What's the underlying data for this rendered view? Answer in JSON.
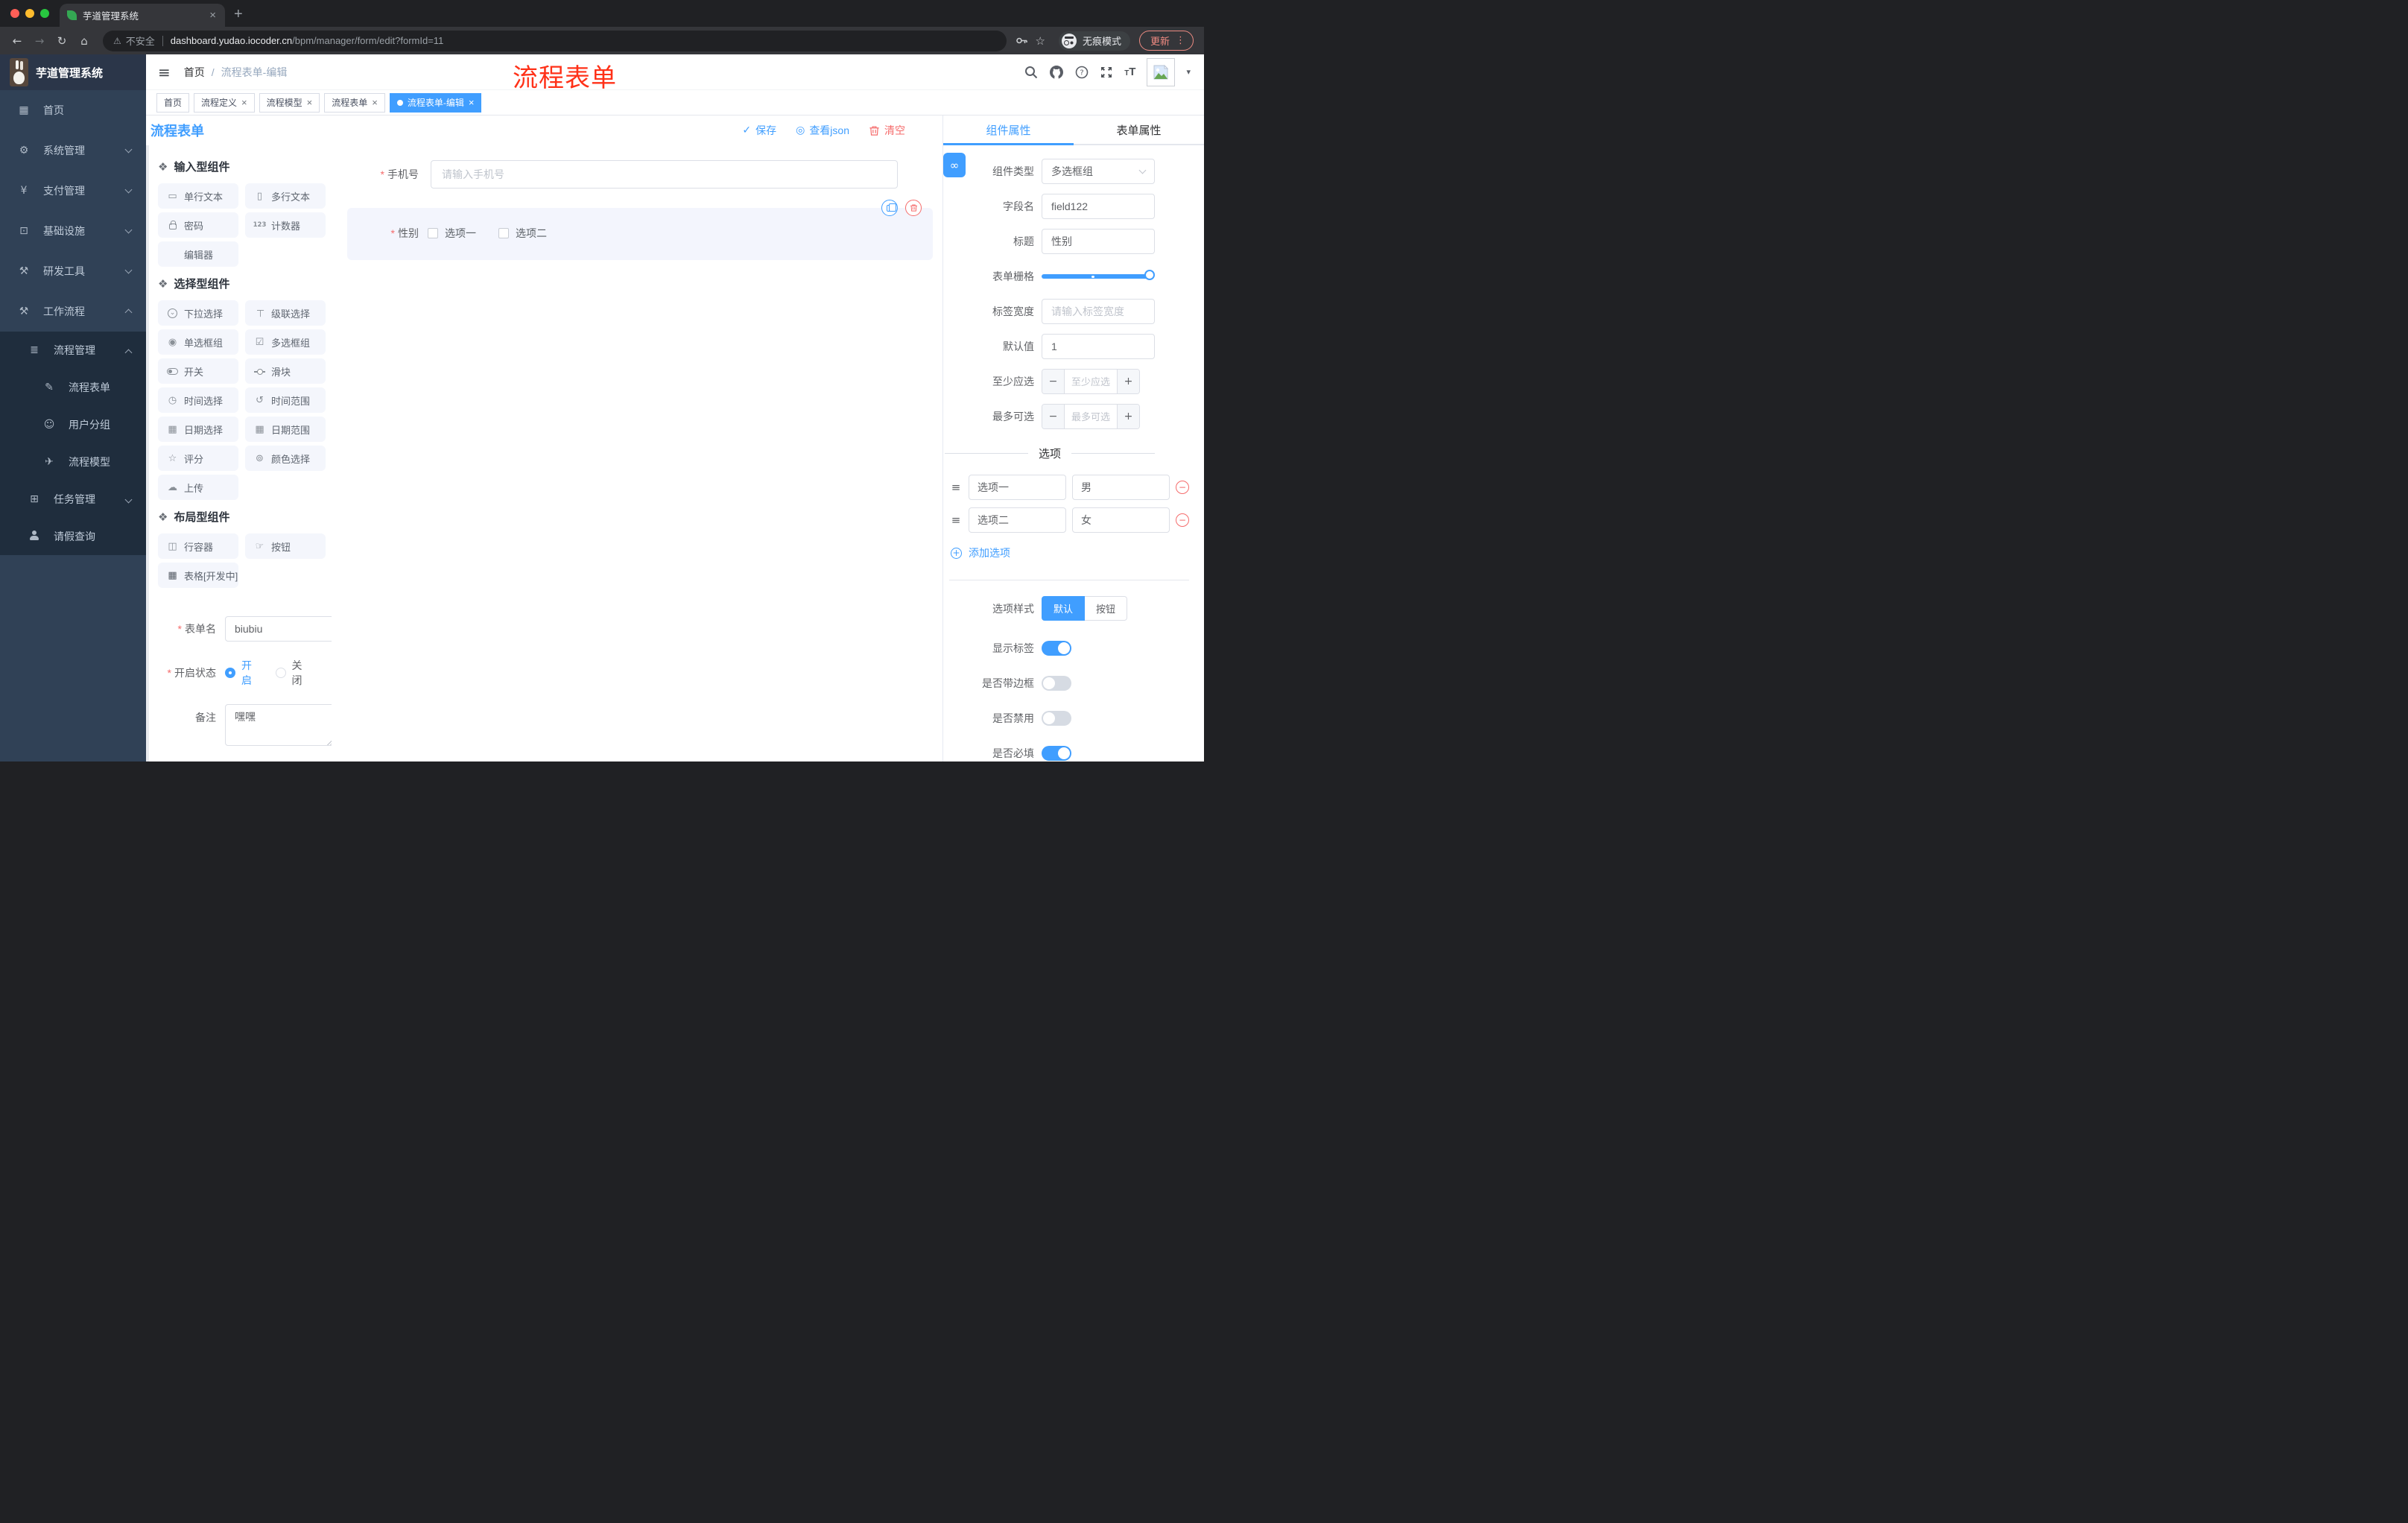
{
  "browser": {
    "tab_title": "芋道管理系统",
    "security_label": "不安全",
    "url_host": "dashboard.yudao.iocoder.cn",
    "url_path": "/bpm/manager/form/edit?formId=11",
    "incognito_label": "无痕模式",
    "update_label": "更新"
  },
  "sidebar": {
    "logo_title": "芋道管理系统",
    "items": [
      {
        "label": "首页",
        "icon": "dashboard-icon"
      },
      {
        "label": "系统管理",
        "icon": "gear-icon"
      },
      {
        "label": "支付管理",
        "icon": "yen-icon"
      },
      {
        "label": "基础设施",
        "icon": "monitor-icon"
      },
      {
        "label": "研发工具",
        "icon": "toolbox-icon"
      },
      {
        "label": "工作流程",
        "icon": "briefcase-icon"
      },
      {
        "label": "流程管理",
        "icon": "list-tree-icon"
      },
      {
        "label": "流程表单",
        "icon": "form-edit-icon"
      },
      {
        "label": "用户分组",
        "icon": "user-group-icon"
      },
      {
        "label": "流程模型",
        "icon": "paper-plane-icon"
      },
      {
        "label": "任务管理",
        "icon": "task-tree-icon"
      },
      {
        "label": "请假查询",
        "icon": "person-icon"
      }
    ]
  },
  "header": {
    "breadcrumb_home": "首页",
    "breadcrumb_sep": "/",
    "breadcrumb_current": "流程表单-编辑",
    "annotation": "流程表单"
  },
  "tags": {
    "items": [
      {
        "label": "首页"
      },
      {
        "label": "流程定义"
      },
      {
        "label": "流程模型"
      },
      {
        "label": "流程表单"
      },
      {
        "label": "流程表单-编辑"
      }
    ]
  },
  "toolbar": {
    "title": "流程表单",
    "save": "保存",
    "view_json": "查看json",
    "clear": "清空"
  },
  "components": {
    "sections": [
      {
        "title": "输入型组件",
        "items": [
          "单行文本",
          "多行文本",
          "密码",
          "计数器",
          "编辑器"
        ]
      },
      {
        "title": "选择型组件",
        "items": [
          "下拉选择",
          "级联选择",
          "单选框组",
          "多选框组",
          "开关",
          "滑块",
          "时间选择",
          "时间范围",
          "日期选择",
          "日期范围",
          "评分",
          "颜色选择",
          "上传"
        ]
      },
      {
        "title": "布局型组件",
        "items": [
          "行容器",
          "按钮",
          "表格[开发中]"
        ]
      }
    ],
    "form": {
      "name_label": "表单名",
      "name_value": "biubiu",
      "status_label": "开启状态",
      "status_on": "开启",
      "status_off": "关闭",
      "remark_label": "备注",
      "remark_value": "嘿嘿"
    }
  },
  "canvas": {
    "phone_label": "手机号",
    "phone_placeholder": "请输入手机号",
    "gender_label": "性别",
    "gender_options": [
      "选项一",
      "选项二"
    ]
  },
  "panel": {
    "tab_component": "组件属性",
    "tab_form": "表单属性",
    "rows": {
      "type_label": "组件类型",
      "type_value": "多选框组",
      "field_label": "字段名",
      "field_value": "field122",
      "title_label": "标题",
      "title_value": "性别",
      "grid_label": "表单栅格",
      "label_width_label": "标签宽度",
      "label_width_placeholder": "请输入标签宽度",
      "default_label": "默认值",
      "default_value": "1",
      "min_label": "至少应选",
      "min_placeholder": "至少应选",
      "max_label": "最多可选",
      "max_placeholder": "最多可选",
      "minus": "−",
      "plus": "+",
      "options_title": "选项",
      "options": [
        {
          "label": "选项一",
          "value": "男"
        },
        {
          "label": "选项二",
          "value": "女"
        }
      ],
      "add_option": "添加选项",
      "style_label": "选项样式",
      "style_default": "默认",
      "style_button": "按钮",
      "show_label": "显示标签",
      "border_label": "是否带边框",
      "disabled_label": "是否禁用",
      "required_label": "是否必填"
    }
  },
  "colors": {
    "primary": "#409EFF",
    "danger": "#F56C6C",
    "annotation_red": "#FF3118",
    "sidebar_bg": "#304156",
    "submenu_bg": "#1F2D3D",
    "chrome_bg": "#202124"
  }
}
